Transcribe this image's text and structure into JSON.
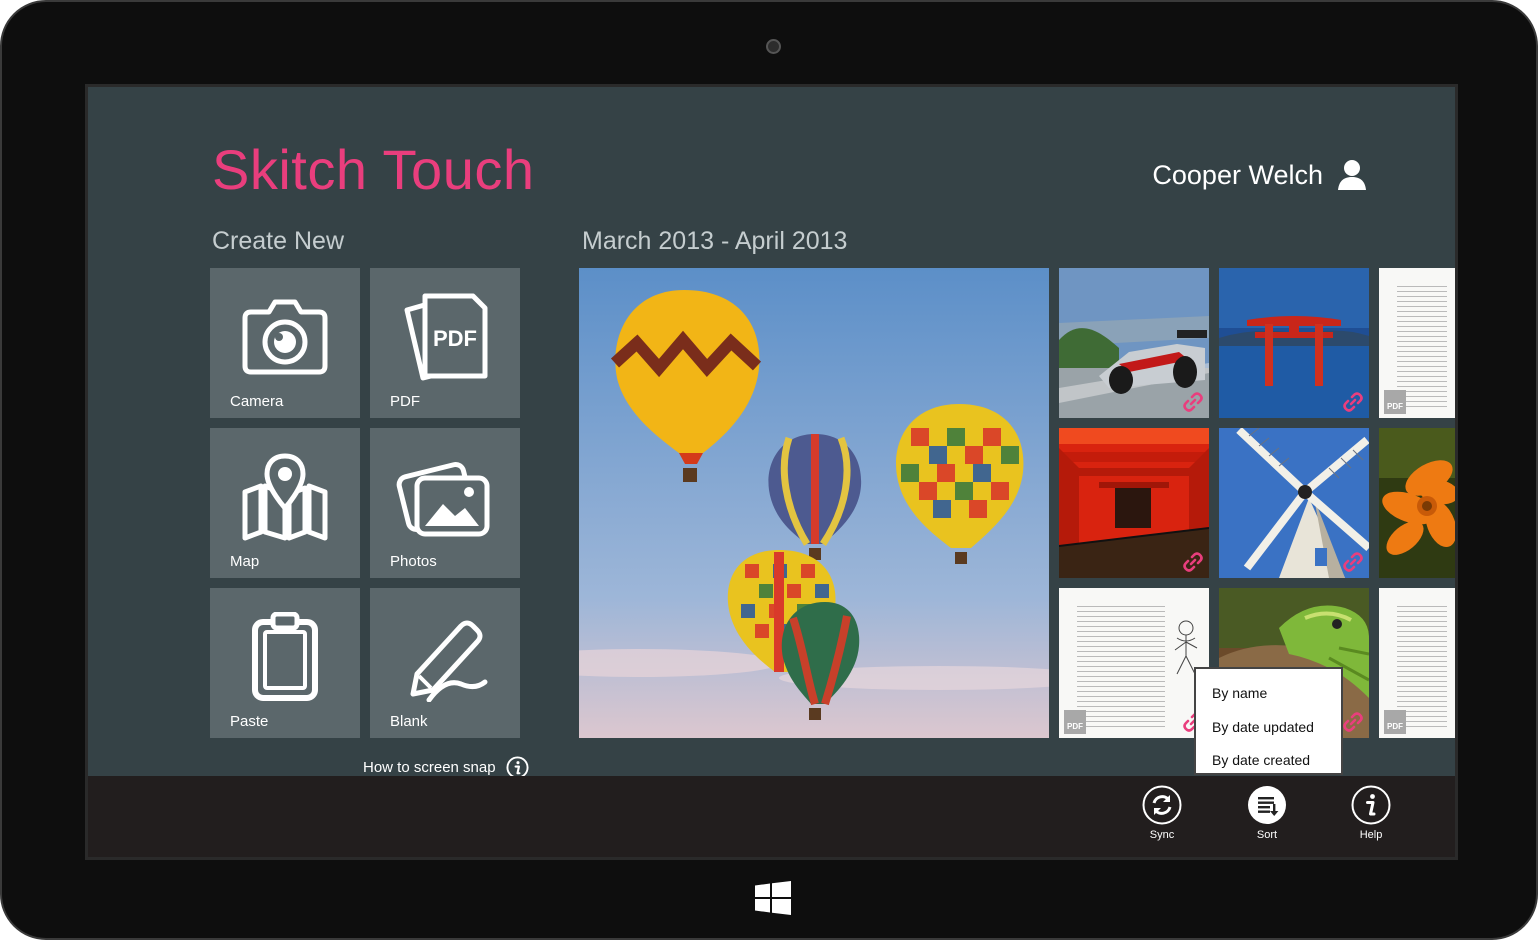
{
  "app": {
    "title": "Skitch Touch"
  },
  "user": {
    "name": "Cooper Welch"
  },
  "create": {
    "heading": "Create New",
    "tiles": [
      {
        "label": "Camera",
        "icon": "camera-icon"
      },
      {
        "label": "PDF",
        "icon": "pdf-icon",
        "icon_text": "PDF"
      },
      {
        "label": "Map",
        "icon": "map-icon"
      },
      {
        "label": "Photos",
        "icon": "photos-icon"
      },
      {
        "label": "Paste",
        "icon": "clipboard-icon"
      },
      {
        "label": "Blank",
        "icon": "pen-icon"
      }
    ],
    "snap_link": "How to screen snap"
  },
  "gallery": {
    "heading": "March 2013 - April 2013",
    "items": [
      {
        "kind": "photo",
        "subject": "hot-air-balloons"
      },
      {
        "kind": "photo",
        "subject": "race-car",
        "linked": true
      },
      {
        "kind": "photo",
        "subject": "torii-gate-water",
        "linked": true
      },
      {
        "kind": "pdf",
        "subject": "document-page",
        "badge": "PDF"
      },
      {
        "kind": "photo",
        "subject": "red-torii-tunnel",
        "linked": true
      },
      {
        "kind": "photo",
        "subject": "windmill",
        "linked": true
      },
      {
        "kind": "photo",
        "subject": "orange-flower"
      },
      {
        "kind": "pdf",
        "subject": "document-page",
        "badge": "PDF",
        "linked": true
      },
      {
        "kind": "photo",
        "subject": "lizard",
        "linked": true
      },
      {
        "kind": "pdf",
        "subject": "document-page",
        "badge": "PDF"
      }
    ]
  },
  "sort_menu": {
    "options": [
      "By name",
      "By date updated",
      "By date created"
    ]
  },
  "appbar": {
    "buttons": [
      {
        "label": "Sync",
        "icon": "sync-icon"
      },
      {
        "label": "Sort",
        "icon": "sort-icon",
        "active": true
      },
      {
        "label": "Help",
        "icon": "info-icon"
      }
    ]
  },
  "colors": {
    "accent": "#e93e7d",
    "background": "#354246",
    "tile": "#5b676b",
    "appbar": "#221e1e"
  }
}
